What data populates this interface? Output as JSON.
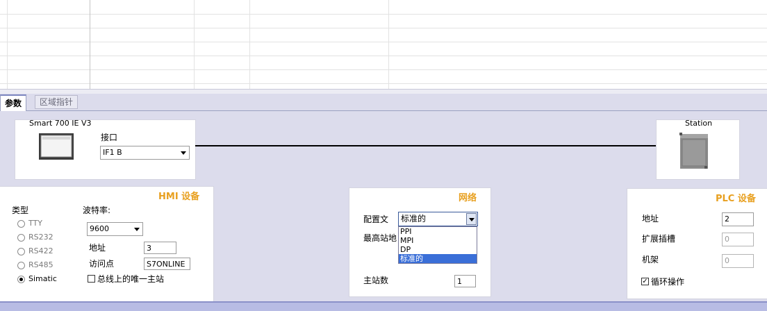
{
  "tabs": {
    "params": "参数",
    "area_pointer": "区域指针"
  },
  "hmi_device": {
    "name": "Smart 700 IE V3",
    "interface_label": "接口",
    "interface_value": "IF1 B"
  },
  "plc_station": {
    "name": "Station"
  },
  "hmi_section": {
    "header": "HMI 设备",
    "type_label": "类型",
    "types": [
      "TTY",
      "RS232",
      "RS422",
      "RS485",
      "Simatic"
    ],
    "selected_type": "Simatic",
    "baud_label": "波特率:",
    "baud_value": "9600",
    "address_label": "地址",
    "address_value": "3",
    "access_point_label": "访问点",
    "access_point_value": "S7ONLINE",
    "only_master_label": "总线上的唯一主站"
  },
  "network_section": {
    "header": "网络",
    "profile_label": "配置文",
    "profile_value": "标准的",
    "profile_options": [
      "PPI",
      "MPI",
      "DP",
      "标准的"
    ],
    "highest_station_label": "最高站地",
    "master_count_label": "主站数",
    "master_count_value": "1"
  },
  "plc_section": {
    "header": "PLC 设备",
    "address_label": "地址",
    "address_value": "2",
    "ext_slot_label": "扩展插槽",
    "ext_slot_value": "0",
    "rack_label": "机架",
    "rack_value": "0",
    "cyclic_label": "循环操作"
  }
}
